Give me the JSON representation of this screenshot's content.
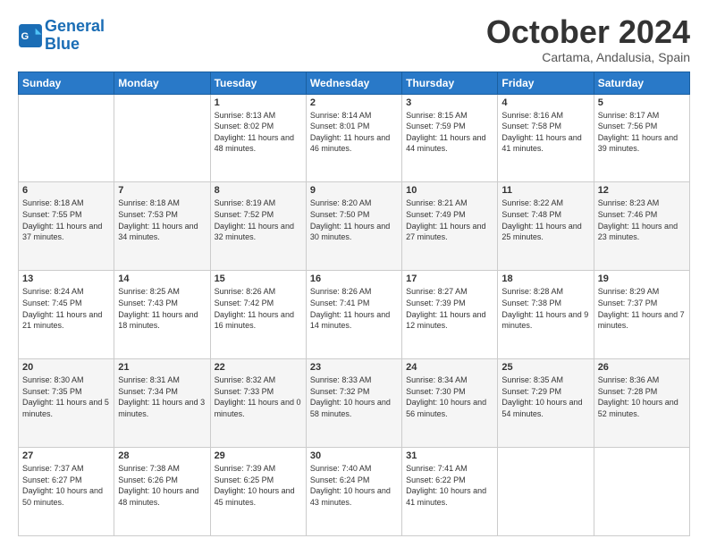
{
  "logo": {
    "line1": "General",
    "line2": "Blue"
  },
  "title": "October 2024",
  "subtitle": "Cartama, Andalusia, Spain",
  "weekdays": [
    "Sunday",
    "Monday",
    "Tuesday",
    "Wednesday",
    "Thursday",
    "Friday",
    "Saturday"
  ],
  "weeks": [
    [
      {
        "day": null
      },
      {
        "day": null
      },
      {
        "day": "1",
        "sunrise": "Sunrise: 8:13 AM",
        "sunset": "Sunset: 8:02 PM",
        "daylight": "Daylight: 11 hours and 48 minutes."
      },
      {
        "day": "2",
        "sunrise": "Sunrise: 8:14 AM",
        "sunset": "Sunset: 8:01 PM",
        "daylight": "Daylight: 11 hours and 46 minutes."
      },
      {
        "day": "3",
        "sunrise": "Sunrise: 8:15 AM",
        "sunset": "Sunset: 7:59 PM",
        "daylight": "Daylight: 11 hours and 44 minutes."
      },
      {
        "day": "4",
        "sunrise": "Sunrise: 8:16 AM",
        "sunset": "Sunset: 7:58 PM",
        "daylight": "Daylight: 11 hours and 41 minutes."
      },
      {
        "day": "5",
        "sunrise": "Sunrise: 8:17 AM",
        "sunset": "Sunset: 7:56 PM",
        "daylight": "Daylight: 11 hours and 39 minutes."
      }
    ],
    [
      {
        "day": "6",
        "sunrise": "Sunrise: 8:18 AM",
        "sunset": "Sunset: 7:55 PM",
        "daylight": "Daylight: 11 hours and 37 minutes."
      },
      {
        "day": "7",
        "sunrise": "Sunrise: 8:18 AM",
        "sunset": "Sunset: 7:53 PM",
        "daylight": "Daylight: 11 hours and 34 minutes."
      },
      {
        "day": "8",
        "sunrise": "Sunrise: 8:19 AM",
        "sunset": "Sunset: 7:52 PM",
        "daylight": "Daylight: 11 hours and 32 minutes."
      },
      {
        "day": "9",
        "sunrise": "Sunrise: 8:20 AM",
        "sunset": "Sunset: 7:50 PM",
        "daylight": "Daylight: 11 hours and 30 minutes."
      },
      {
        "day": "10",
        "sunrise": "Sunrise: 8:21 AM",
        "sunset": "Sunset: 7:49 PM",
        "daylight": "Daylight: 11 hours and 27 minutes."
      },
      {
        "day": "11",
        "sunrise": "Sunrise: 8:22 AM",
        "sunset": "Sunset: 7:48 PM",
        "daylight": "Daylight: 11 hours and 25 minutes."
      },
      {
        "day": "12",
        "sunrise": "Sunrise: 8:23 AM",
        "sunset": "Sunset: 7:46 PM",
        "daylight": "Daylight: 11 hours and 23 minutes."
      }
    ],
    [
      {
        "day": "13",
        "sunrise": "Sunrise: 8:24 AM",
        "sunset": "Sunset: 7:45 PM",
        "daylight": "Daylight: 11 hours and 21 minutes."
      },
      {
        "day": "14",
        "sunrise": "Sunrise: 8:25 AM",
        "sunset": "Sunset: 7:43 PM",
        "daylight": "Daylight: 11 hours and 18 minutes."
      },
      {
        "day": "15",
        "sunrise": "Sunrise: 8:26 AM",
        "sunset": "Sunset: 7:42 PM",
        "daylight": "Daylight: 11 hours and 16 minutes."
      },
      {
        "day": "16",
        "sunrise": "Sunrise: 8:26 AM",
        "sunset": "Sunset: 7:41 PM",
        "daylight": "Daylight: 11 hours and 14 minutes."
      },
      {
        "day": "17",
        "sunrise": "Sunrise: 8:27 AM",
        "sunset": "Sunset: 7:39 PM",
        "daylight": "Daylight: 11 hours and 12 minutes."
      },
      {
        "day": "18",
        "sunrise": "Sunrise: 8:28 AM",
        "sunset": "Sunset: 7:38 PM",
        "daylight": "Daylight: 11 hours and 9 minutes."
      },
      {
        "day": "19",
        "sunrise": "Sunrise: 8:29 AM",
        "sunset": "Sunset: 7:37 PM",
        "daylight": "Daylight: 11 hours and 7 minutes."
      }
    ],
    [
      {
        "day": "20",
        "sunrise": "Sunrise: 8:30 AM",
        "sunset": "Sunset: 7:35 PM",
        "daylight": "Daylight: 11 hours and 5 minutes."
      },
      {
        "day": "21",
        "sunrise": "Sunrise: 8:31 AM",
        "sunset": "Sunset: 7:34 PM",
        "daylight": "Daylight: 11 hours and 3 minutes."
      },
      {
        "day": "22",
        "sunrise": "Sunrise: 8:32 AM",
        "sunset": "Sunset: 7:33 PM",
        "daylight": "Daylight: 11 hours and 0 minutes."
      },
      {
        "day": "23",
        "sunrise": "Sunrise: 8:33 AM",
        "sunset": "Sunset: 7:32 PM",
        "daylight": "Daylight: 10 hours and 58 minutes."
      },
      {
        "day": "24",
        "sunrise": "Sunrise: 8:34 AM",
        "sunset": "Sunset: 7:30 PM",
        "daylight": "Daylight: 10 hours and 56 minutes."
      },
      {
        "day": "25",
        "sunrise": "Sunrise: 8:35 AM",
        "sunset": "Sunset: 7:29 PM",
        "daylight": "Daylight: 10 hours and 54 minutes."
      },
      {
        "day": "26",
        "sunrise": "Sunrise: 8:36 AM",
        "sunset": "Sunset: 7:28 PM",
        "daylight": "Daylight: 10 hours and 52 minutes."
      }
    ],
    [
      {
        "day": "27",
        "sunrise": "Sunrise: 7:37 AM",
        "sunset": "Sunset: 6:27 PM",
        "daylight": "Daylight: 10 hours and 50 minutes."
      },
      {
        "day": "28",
        "sunrise": "Sunrise: 7:38 AM",
        "sunset": "Sunset: 6:26 PM",
        "daylight": "Daylight: 10 hours and 48 minutes."
      },
      {
        "day": "29",
        "sunrise": "Sunrise: 7:39 AM",
        "sunset": "Sunset: 6:25 PM",
        "daylight": "Daylight: 10 hours and 45 minutes."
      },
      {
        "day": "30",
        "sunrise": "Sunrise: 7:40 AM",
        "sunset": "Sunset: 6:24 PM",
        "daylight": "Daylight: 10 hours and 43 minutes."
      },
      {
        "day": "31",
        "sunrise": "Sunrise: 7:41 AM",
        "sunset": "Sunset: 6:22 PM",
        "daylight": "Daylight: 10 hours and 41 minutes."
      },
      {
        "day": null
      },
      {
        "day": null
      }
    ]
  ]
}
